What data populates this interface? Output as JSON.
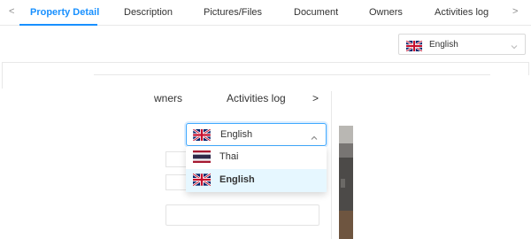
{
  "tabs": {
    "prev_arrow": "<",
    "next_arrow": ">",
    "items": [
      {
        "label": "Property Detail",
        "active": true
      },
      {
        "label": "Description"
      },
      {
        "label": "Pictures/Files"
      },
      {
        "label": "Document"
      },
      {
        "label": "Owners"
      },
      {
        "label": "Activities log"
      }
    ]
  },
  "language_select": {
    "value": "English",
    "flag_icon": "uk-flag-icon",
    "chevron_icon": "chevron-down-icon"
  },
  "zoomed": {
    "tabs": {
      "owners_partial": "wners",
      "activities_log": "Activities log",
      "next_arrow": ">"
    },
    "language_select": {
      "value": "English",
      "flag_icon": "uk-flag-icon",
      "chevron_icon": "chevron-up-icon",
      "open": true
    },
    "dropdown_options": [
      {
        "label": "Thai",
        "flag_icon": "thai-flag-icon",
        "selected": false
      },
      {
        "label": "English",
        "flag_icon": "uk-flag-icon",
        "selected": true
      }
    ]
  },
  "colors": {
    "accent": "#1890ff",
    "selected_option_bg": "#e6f7ff",
    "border": "#d9d9d9"
  }
}
